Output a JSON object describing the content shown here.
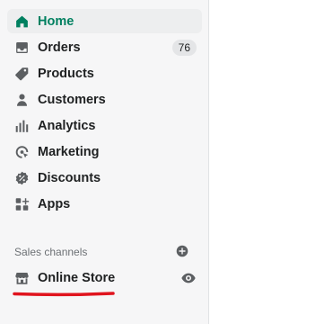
{
  "nav": {
    "items": [
      {
        "label": "Home",
        "icon": "home-icon",
        "active": true
      },
      {
        "label": "Orders",
        "icon": "orders-icon",
        "badge": "76"
      },
      {
        "label": "Products",
        "icon": "tag-icon"
      },
      {
        "label": "Customers",
        "icon": "person-icon"
      },
      {
        "label": "Analytics",
        "icon": "bar-chart-icon"
      },
      {
        "label": "Marketing",
        "icon": "target-icon"
      },
      {
        "label": "Discounts",
        "icon": "discount-icon"
      },
      {
        "label": "Apps",
        "icon": "apps-icon"
      }
    ]
  },
  "sales_channels": {
    "title": "Sales channels",
    "add_icon": "plus-circle-icon",
    "items": [
      {
        "label": "Online Store",
        "icon": "store-icon",
        "action_icon": "eye-icon"
      }
    ]
  },
  "colors": {
    "active_text": "#008060",
    "text": "#202223",
    "muted": "#6d7175",
    "sidebar_bg": "#f6f6f7",
    "annotation": "#e0141e"
  }
}
